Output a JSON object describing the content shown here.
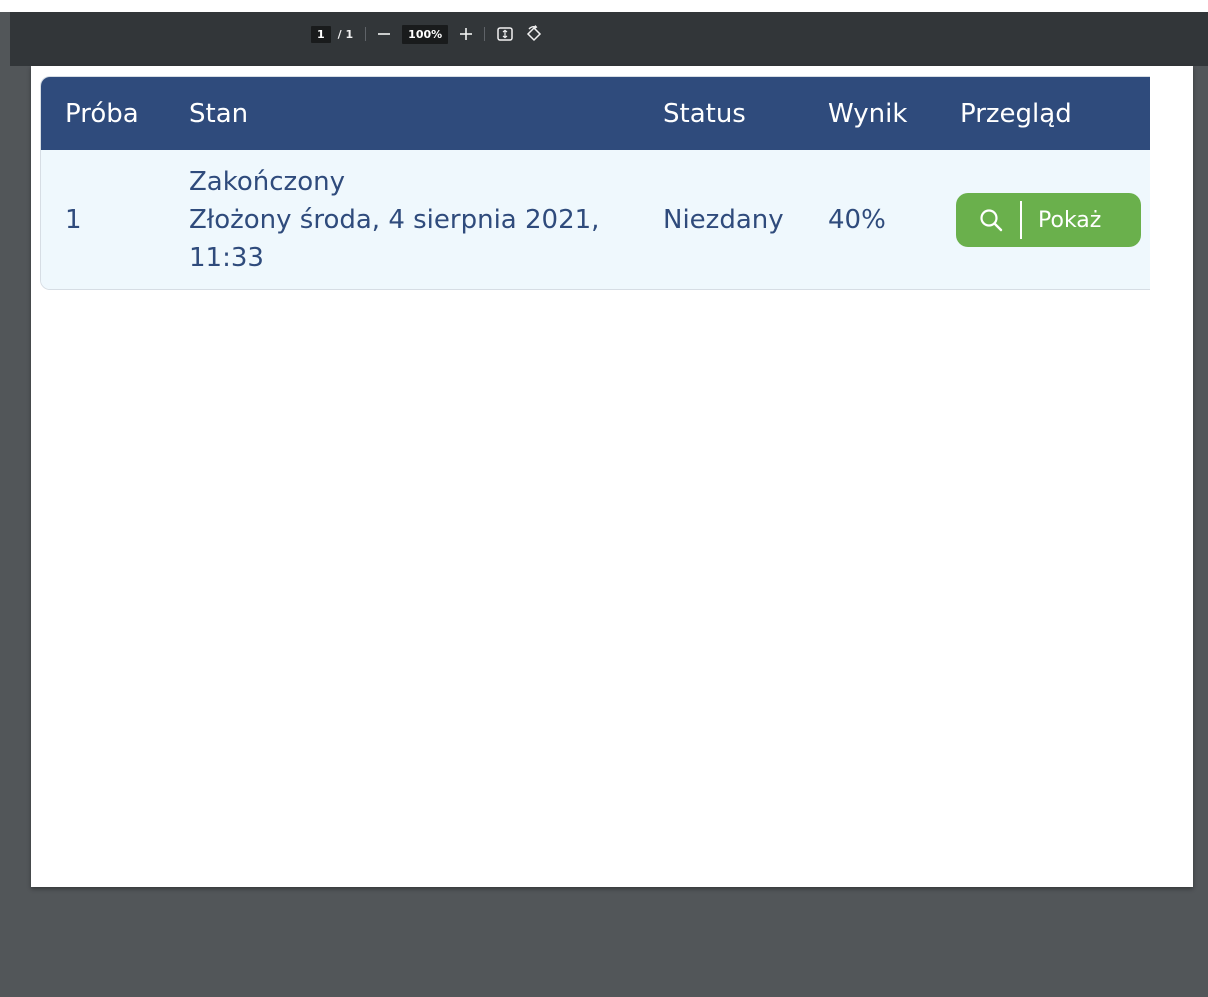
{
  "toolbar": {
    "page_current": "1",
    "page_total": "/ 1",
    "zoom": "100%",
    "zoom_out_icon": "minus-icon",
    "zoom_in_icon": "plus-icon",
    "fit_icon": "fit-page-icon",
    "rotate_icon": "rotate-icon"
  },
  "table": {
    "headers": [
      "Próba",
      "Stan",
      "Status",
      "Wynik",
      "Przegląd"
    ],
    "rows": [
      {
        "attempt": "1",
        "state_line1": "Zakończony",
        "state_line2": "Złożony środa, 4 sierpnia 2021,",
        "state_line3": "11:33",
        "status": "Niezdany",
        "score": "40%",
        "review_label": "Pokaż",
        "review_icon": "search-icon"
      }
    ]
  },
  "colors": {
    "header_bg": "#2f4b7c",
    "row_bg": "#eff8fd",
    "button_bg": "#6ab04c",
    "viewer_bg": "#525659",
    "toolbar_bg": "#323639"
  }
}
